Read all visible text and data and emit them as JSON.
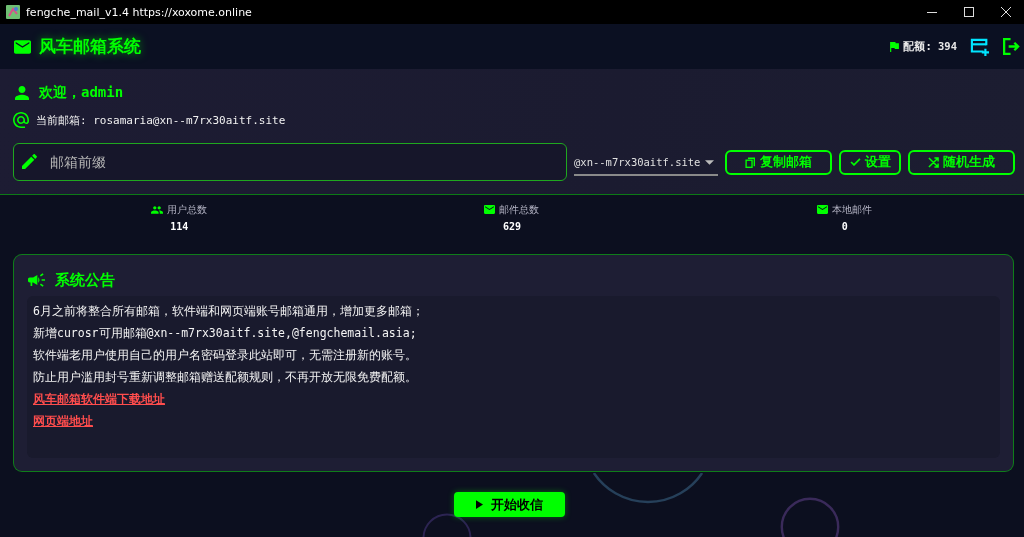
{
  "window": {
    "title": "fengche_mail_v1.4 https://xoxome.online"
  },
  "header": {
    "title": "风车邮箱系统",
    "quota": "配额: 394"
  },
  "user": {
    "welcome": "欢迎，admin",
    "current_email": "当前邮箱: rosamaria@xn--m7rx30aitf.site"
  },
  "compose": {
    "prefix": {
      "placeholder": "邮箱前缀"
    },
    "domain": {
      "value": "@xn--m7rx30aitf.site"
    },
    "buttons": [
      {
        "label": "复制邮箱",
        "kind": "copy"
      },
      {
        "label": "设置",
        "kind": "confirm"
      },
      {
        "label": "随机生成",
        "kind": "random"
      }
    ]
  },
  "stats": [
    {
      "label": "用户总数",
      "value": "114",
      "kind": "users"
    },
    {
      "label": "邮件总数",
      "value": "629",
      "kind": "mail"
    },
    {
      "label": "本地邮件",
      "value": "0",
      "kind": "mail"
    }
  ],
  "notice": {
    "title": "系统公告",
    "lines": [
      {
        "kind": "text",
        "text": "6月之前将整合所有邮箱，软件端和网页端账号邮箱通用，增加更多邮箱；"
      },
      {
        "kind": "text",
        "text": "新增curosr可用邮箱@xn--m7rx30aitf.site,@fengchemail.asia;"
      },
      {
        "kind": "text",
        "text": "软件端老用户使用自己的用户名密码登录此站即可，无需注册新的账号。"
      },
      {
        "kind": "text",
        "text": "防止用户滥用封号重新调整邮箱赠送配额规则，不再开放无限免费配额。"
      },
      {
        "kind": "link",
        "text": "风车邮箱软件端下载地址"
      },
      {
        "kind": "link",
        "text": "网页端地址"
      }
    ]
  },
  "action": {
    "label": "开始收信"
  }
}
